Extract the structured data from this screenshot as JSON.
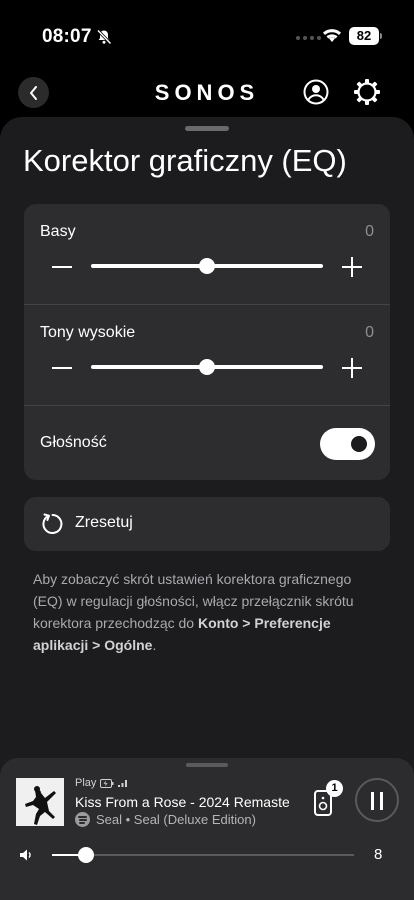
{
  "status_bar": {
    "time": "08:07",
    "battery": "82"
  },
  "header": {
    "brand": "SONOS"
  },
  "page": {
    "title": "Korektor graficzny (EQ)"
  },
  "eq": {
    "bass": {
      "label": "Basy",
      "value": "0",
      "level": 0.5
    },
    "treble": {
      "label": "Tony wysokie",
      "value": "0",
      "level": 0.5
    },
    "loudness": {
      "label": "Głośność",
      "enabled": true
    }
  },
  "reset": {
    "label": "Zresetuj"
  },
  "info": {
    "text_before": "Aby zobaczyć skrót ustawień korektora graficznego (EQ) w regulacji głośności, włącz przełącznik skrótu korektora przechodząc do ",
    "text_bold": "Konto > Preferencje aplikacji > Ogólne",
    "text_after": "."
  },
  "player": {
    "source": "Play",
    "track_title": "Kiss From a Rose - 2024 Remaster",
    "artist_line": "Seal • Seal (Deluxe Edition)",
    "speaker_count": "1",
    "volume": "8",
    "volume_level": 0.08
  },
  "colors": {
    "background": "#000000",
    "sheet": "#1c1c1e",
    "card": "#2d2d2f",
    "player": "#2c2c2e",
    "muted_text": "#8e8e93"
  }
}
